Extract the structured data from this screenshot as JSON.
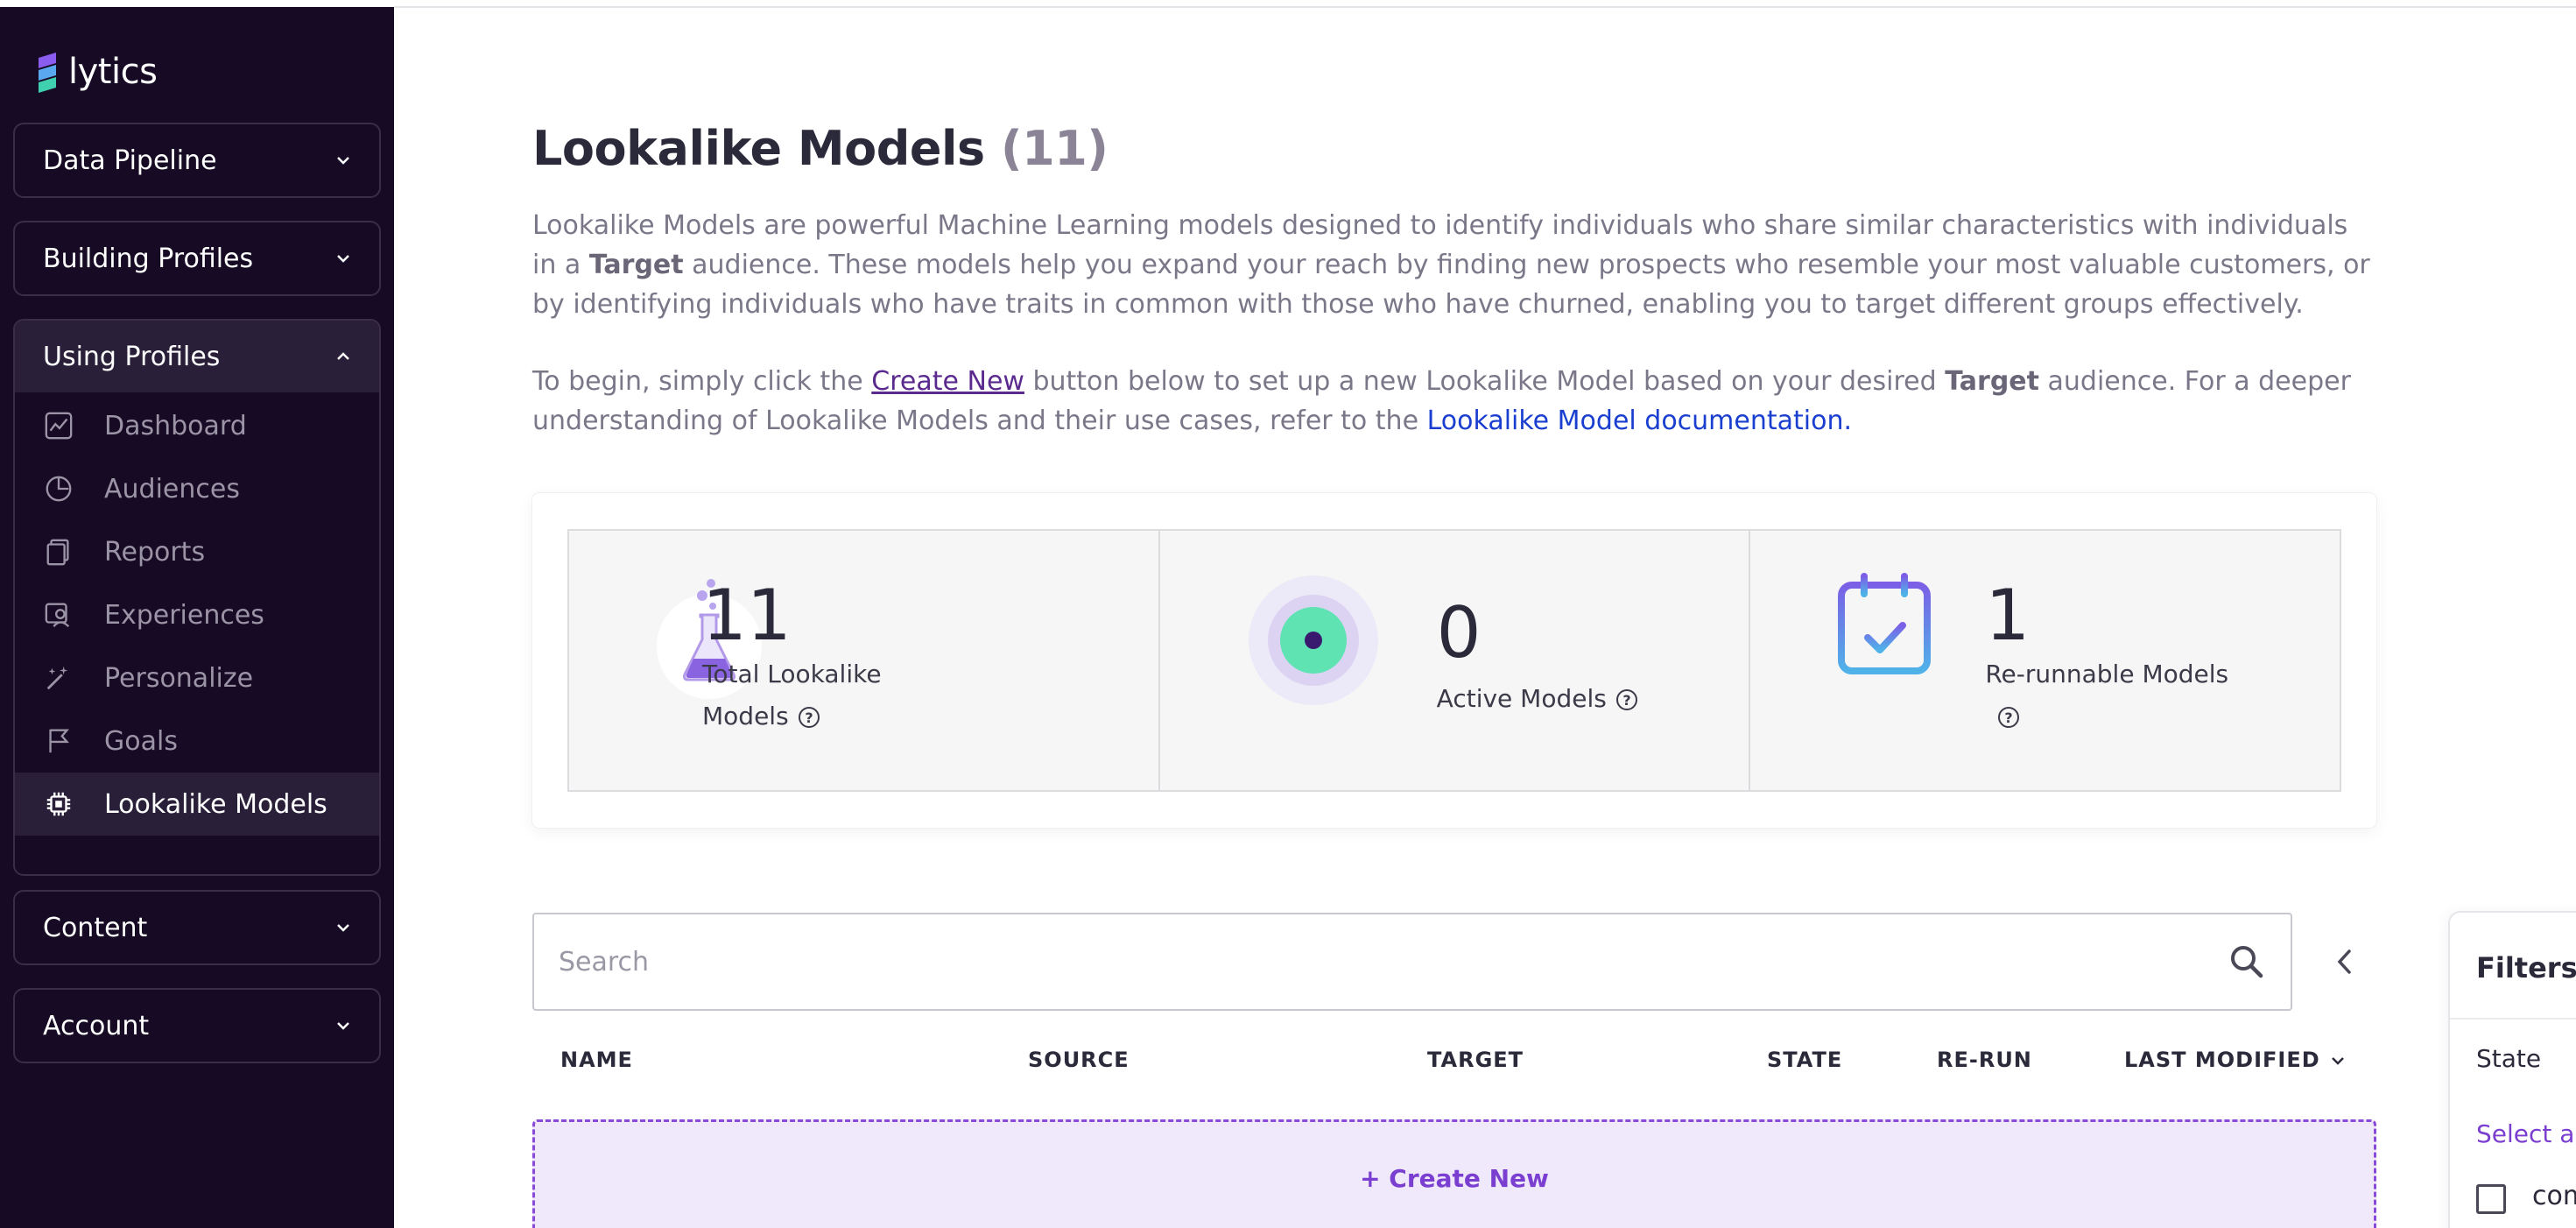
{
  "app": {
    "name": "lytics",
    "accent": "#7a3fd0",
    "sidebar_bg": "#170a24"
  },
  "sidebar": {
    "groups": [
      {
        "label": "Data Pipeline",
        "expanded": false
      },
      {
        "label": "Building Profiles",
        "expanded": false
      },
      {
        "label": "Using Profiles",
        "expanded": true,
        "items": [
          {
            "label": "Dashboard",
            "icon": "chart-icon"
          },
          {
            "label": "Audiences",
            "icon": "pie-icon"
          },
          {
            "label": "Reports",
            "icon": "copy-icon"
          },
          {
            "label": "Experiences",
            "icon": "profile-card-icon"
          },
          {
            "label": "Personalize",
            "icon": "magic-wand-icon"
          },
          {
            "label": "Goals",
            "icon": "flag-icon"
          },
          {
            "label": "Lookalike Models",
            "icon": "chip-icon",
            "active": true
          }
        ]
      },
      {
        "label": "Content",
        "expanded": false
      },
      {
        "label": "Account",
        "expanded": false
      }
    ]
  },
  "page": {
    "title": "Lookalike Models",
    "count": "(11)",
    "intro": {
      "t1": "Lookalike Models are powerful Machine Learning models designed to identify individuals who share similar characteristics with individuals in a ",
      "b1": "Target",
      "t2": " audience. These models help you expand your reach by finding new prospects who resemble your most valuable customers, or by identifying individuals who have traits in common with those who have churned, enabling you to target different groups effectively."
    },
    "begin": {
      "t1": "To begin, simply click the ",
      "link1": "Create New",
      "t2": " button below to set up a new Lookalike Model based on your desired ",
      "b1": "Target",
      "t3": " audience. For a deeper understanding of Lookalike Models and their use cases, refer to the ",
      "link2": "Lookalike Model documentation."
    }
  },
  "stats": [
    {
      "value": "11",
      "label_line1": "Total Lookalike",
      "label_line2": "Models",
      "icon": "flask-icon"
    },
    {
      "value": "0",
      "label_line1": "Active Models",
      "icon": "target-dot-icon"
    },
    {
      "value": "1",
      "label_line1": "Re-runnable Models",
      "icon": "calendar-check-icon"
    }
  ],
  "search": {
    "placeholder": "Search"
  },
  "table": {
    "columns": [
      "NAME",
      "SOURCE",
      "TARGET",
      "STATE",
      "RE-RUN",
      "LAST MODIFIED"
    ]
  },
  "create_new": {
    "label": "+ Create New"
  },
  "filters": {
    "title": "Filters",
    "state_label": "State",
    "select_all": "Select all",
    "option": "completed"
  }
}
